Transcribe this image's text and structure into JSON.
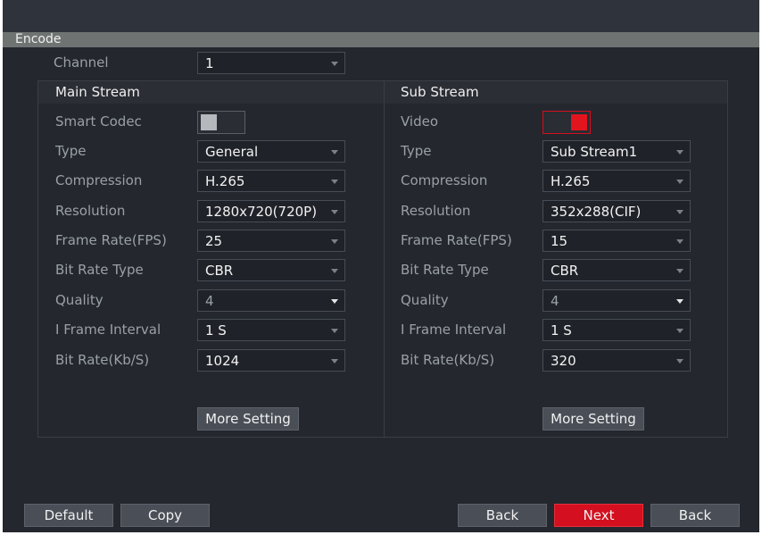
{
  "window": {
    "title": "Encode"
  },
  "channel": {
    "label": "Channel",
    "value": "1"
  },
  "main_stream": {
    "title": "Main Stream",
    "smart_codec_label": "Smart Codec",
    "rows": [
      {
        "label": "Type",
        "value": "General"
      },
      {
        "label": "Compression",
        "value": "H.265"
      },
      {
        "label": "Resolution",
        "value": "1280x720(720P)"
      },
      {
        "label": "Frame Rate(FPS)",
        "value": "25"
      },
      {
        "label": "Bit Rate Type",
        "value": "CBR"
      },
      {
        "label": "Quality",
        "value": "4"
      },
      {
        "label": "I Frame Interval",
        "value": "1 S"
      },
      {
        "label": "Bit Rate(Kb/S)",
        "value": "1024"
      }
    ],
    "more_setting": "More Setting"
  },
  "sub_stream": {
    "title": "Sub Stream",
    "video_label": "Video",
    "rows": [
      {
        "label": "Type",
        "value": "Sub Stream1"
      },
      {
        "label": "Compression",
        "value": "H.265"
      },
      {
        "label": "Resolution",
        "value": "352x288(CIF)"
      },
      {
        "label": "Frame Rate(FPS)",
        "value": "15"
      },
      {
        "label": "Bit Rate Type",
        "value": "CBR"
      },
      {
        "label": "Quality",
        "value": "4"
      },
      {
        "label": "I Frame Interval",
        "value": "1 S"
      },
      {
        "label": "Bit Rate(Kb/S)",
        "value": "320"
      }
    ],
    "more_setting": "More Setting"
  },
  "footer": {
    "default": "Default",
    "copy": "Copy",
    "back1": "Back",
    "next": "Next",
    "back2": "Back"
  },
  "colors": {
    "accent_red": "#d40f1f",
    "background": "#24272e"
  }
}
